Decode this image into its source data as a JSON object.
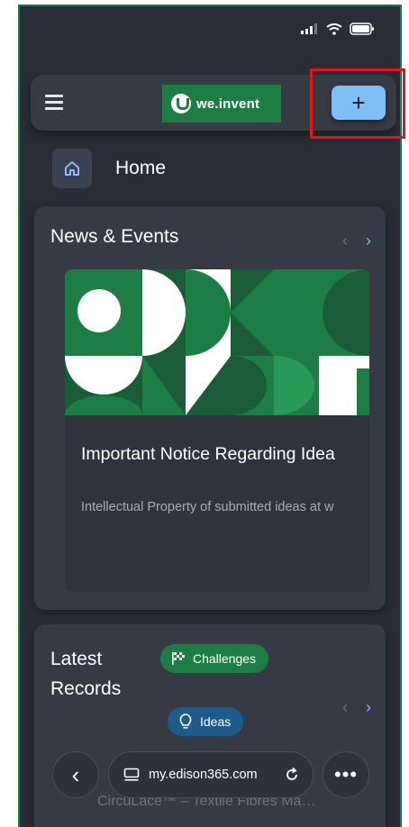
{
  "app_bar": {
    "logo_text": "we.invent",
    "add_label": "+"
  },
  "home": {
    "label": "Home"
  },
  "news": {
    "title": "News & Events",
    "prev": "‹",
    "next": "›",
    "item_title": "Important Notice Regarding Idea",
    "item_description": "Intellectual Property of submitted ideas at w"
  },
  "records": {
    "title": "Latest Records",
    "chip_challenges": "Challenges",
    "chip_ideas": "Ideas",
    "prev": "‹",
    "next": "›",
    "peek_text": "CircuLace™ – Textile Fibres Ma…"
  },
  "browser": {
    "url": "my.edison365.com",
    "back": "‹",
    "more": "•••"
  },
  "colors": {
    "background": "#2a2d35",
    "card": "#363a44",
    "brand_green": "#1e7d45",
    "accent_blue": "#7fbff5",
    "highlight_red": "#e5141a"
  }
}
